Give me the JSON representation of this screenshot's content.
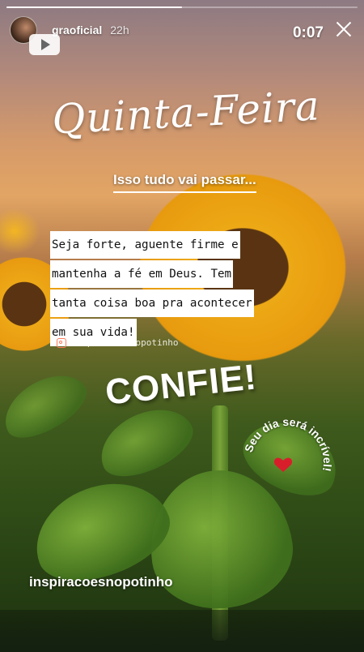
{
  "story": {
    "username": "graoficial",
    "time_ago": "22h",
    "timer": "0:07",
    "progress": 0.5
  },
  "content": {
    "title": "Quinta-Feira",
    "subtitle": "Isso tudo vai passar...",
    "quote_lines": [
      "Seja forte, aguente firme e",
      "mantenha a fé em Deus. Tem",
      "tanta coisa boa pra acontecer",
      "em sua vida!"
    ],
    "handle": "inspiracoesnopotinho",
    "confie": "CONFIE!",
    "circle_text": "Seu dia será incrível!",
    "footer_tag": "inspiracoesnopotinho"
  },
  "icons": {
    "close": "close-icon",
    "video": "video-play-icon",
    "heart": "heart-icon",
    "instagram": "instagram-icon"
  },
  "colors": {
    "heart": "#d81e2a",
    "handle_icon": "#ff7a5a"
  }
}
